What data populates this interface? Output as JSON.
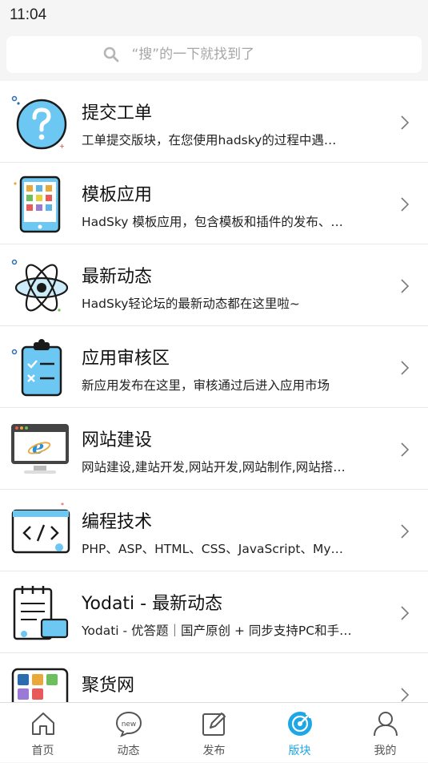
{
  "status": {
    "time": "11:04"
  },
  "search": {
    "placeholder": "“搜”的一下就找到了"
  },
  "sections": [
    {
      "title": "提交工单",
      "desc": "工单提交版块，在您使用hadsky的过程中遇…",
      "icon": "question-icon"
    },
    {
      "title": "模板应用",
      "desc": "HadSky 模板应用，包含模板和插件的发布、…",
      "icon": "phone-apps-icon"
    },
    {
      "title": "最新动态",
      "desc": "HadSky轻论坛的最新动态都在这里啦~",
      "icon": "atom-icon"
    },
    {
      "title": "应用审核区",
      "desc": "新应用发布在这里，审核通过后进入应用市场",
      "icon": "clipboard-checklist-icon"
    },
    {
      "title": "网站建设",
      "desc": "网站建设,建站开发,网站开发,网站制作,网站搭…",
      "icon": "browser-monitor-icon"
    },
    {
      "title": "编程技术",
      "desc": "PHP、ASP、HTML、CSS、JavaScript、My…",
      "icon": "code-window-icon"
    },
    {
      "title": "Yodati - 最新动态",
      "desc": "Yodati - 优答题｜国产原创 + 同步支持PC和手…",
      "icon": "notebook-icon"
    },
    {
      "title": "聚货网",
      "desc": "",
      "icon": "design-apps-icon"
    }
  ],
  "tabbar": [
    {
      "label": "首页",
      "icon": "home-icon",
      "active": false
    },
    {
      "label": "动态",
      "icon": "new-bubble-icon",
      "active": false
    },
    {
      "label": "发布",
      "icon": "edit-icon",
      "active": false
    },
    {
      "label": "版块",
      "icon": "compass-icon",
      "active": true
    },
    {
      "label": "我的",
      "icon": "user-icon",
      "active": false
    }
  ],
  "colors": {
    "accent": "#1ea7e7",
    "icon_blue": "#6cc8f2",
    "icon_dark": "#1a1a1a"
  }
}
